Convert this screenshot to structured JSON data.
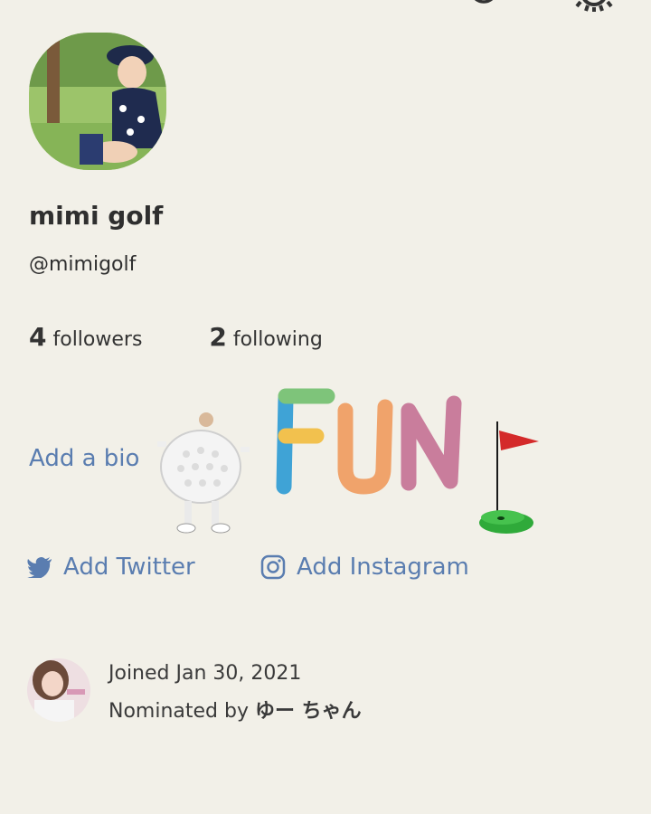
{
  "profile": {
    "name": "mimi golf",
    "username": "@mimigolf",
    "followers_count": "4",
    "followers_label": "followers",
    "following_count": "2",
    "following_label": "following",
    "bio_link": "Add a bio"
  },
  "social": {
    "twitter_label": "Add Twitter",
    "instagram_label": "Add Instagram"
  },
  "meta": {
    "joined": "Joined Jan 30, 2021",
    "nominated_prefix": "Nominated by",
    "nominator_name": "ゆー ちゃん"
  },
  "art": {
    "fun_text": "FUN"
  },
  "colors": {
    "background": "#F2F0E8",
    "link": "#5A7DB0",
    "text": "#2f2f2f"
  },
  "icons": [
    "back-icon",
    "search-icon",
    "gear-icon",
    "twitter-icon",
    "instagram-icon"
  ]
}
